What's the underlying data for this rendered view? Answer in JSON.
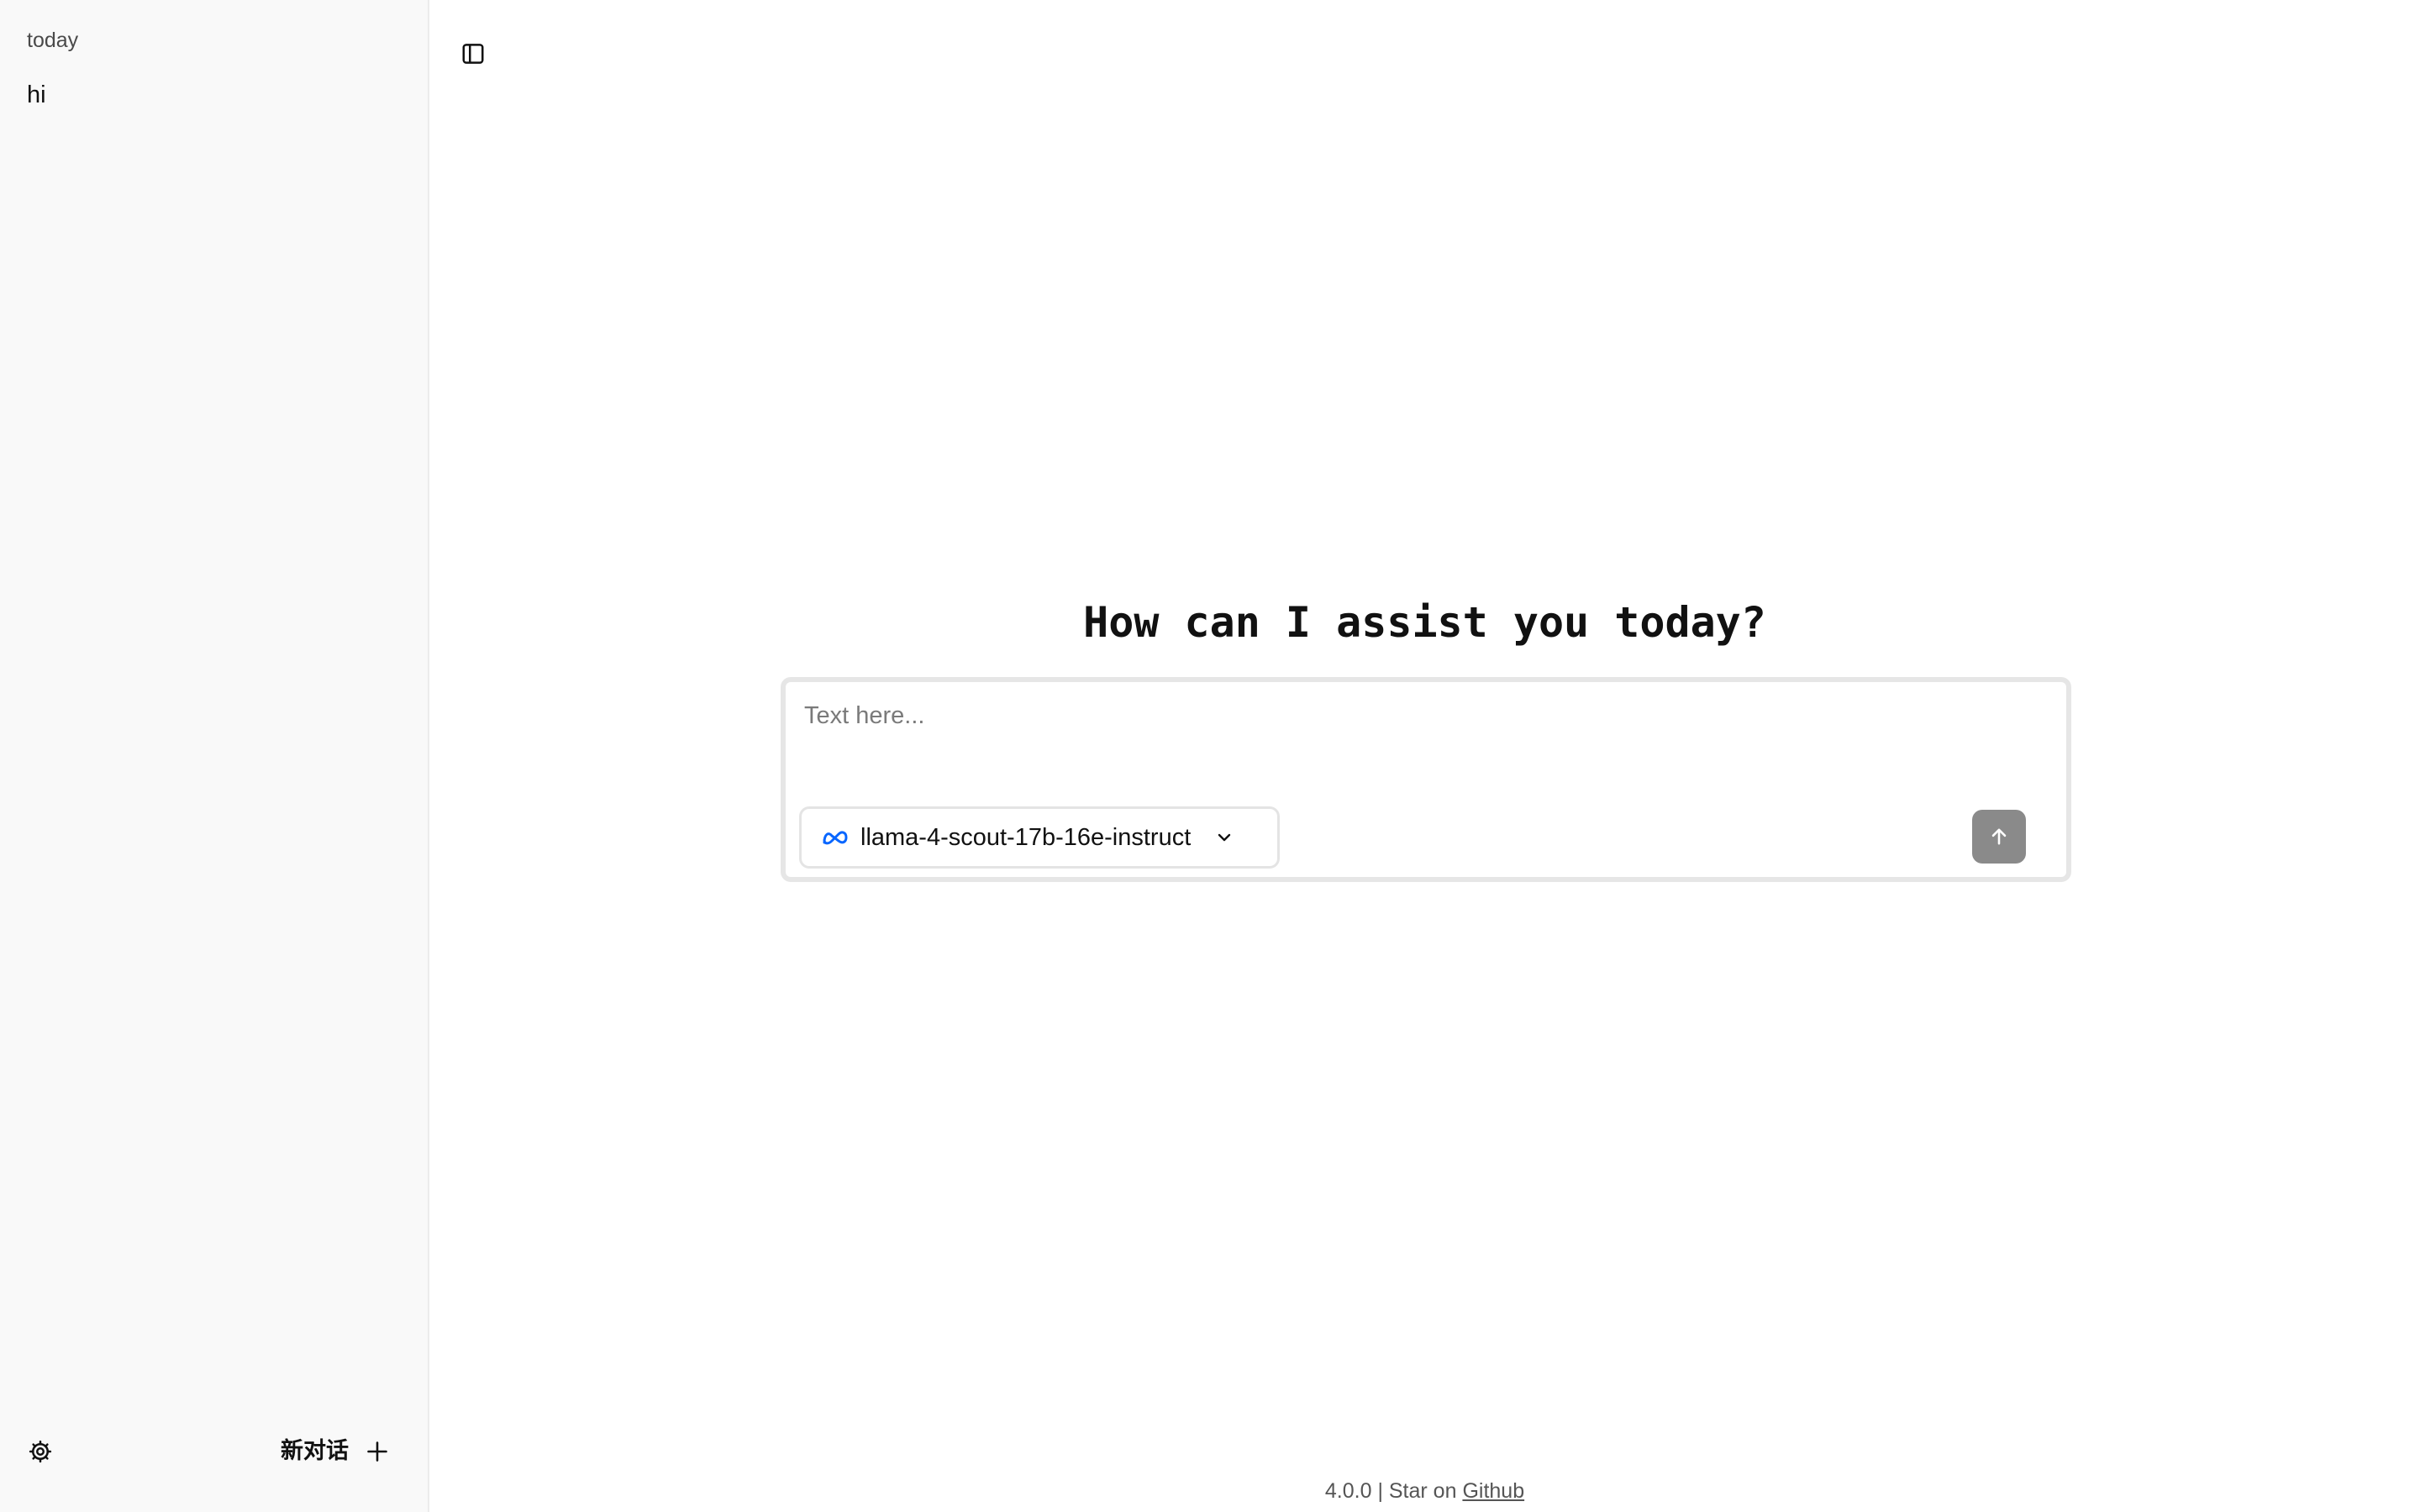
{
  "sidebar": {
    "section_label": "today",
    "conversations": [
      {
        "title": "hi"
      }
    ],
    "footer": {
      "settings_icon": "gear-icon",
      "new_chat_label": "新对话",
      "new_chat_icon": "plus-icon"
    }
  },
  "main": {
    "toggle_icon": "sidebar-toggle-icon",
    "headline": "How can I assist you today?",
    "composer": {
      "placeholder": "Text here...",
      "value": "",
      "model": {
        "icon": "meta-logo-icon",
        "name": "llama-4-scout-17b-16e-instruct",
        "chevron_icon": "chevron-down-icon"
      },
      "send_icon": "arrow-up-icon"
    },
    "footer": {
      "version_text": "4.0.0 | Star on ",
      "link_text": "Github"
    }
  },
  "colors": {
    "sidebar_bg": "#f9f9f9",
    "send_button_bg": "#8a8a8a",
    "meta_blue": "#0866ff"
  }
}
